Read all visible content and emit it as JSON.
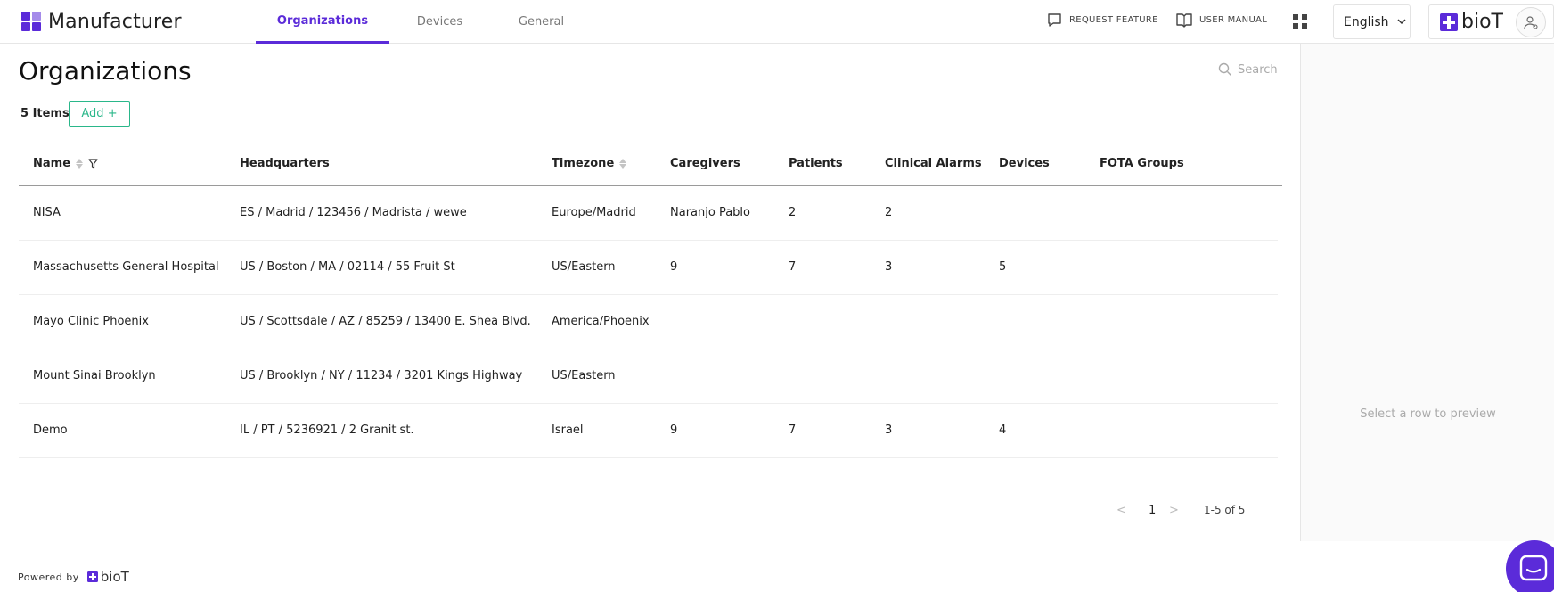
{
  "app": {
    "brand_name": "Manufacturer",
    "company_logo_text": "bioT",
    "brand_color": "#5b2bd9",
    "accent_color": "#2ab78a"
  },
  "nav": {
    "tabs": [
      {
        "label": "Organizations",
        "active": true
      },
      {
        "label": "Devices",
        "active": false
      },
      {
        "label": "General",
        "active": false
      }
    ]
  },
  "header": {
    "request_feature": "REQUEST FEATURE",
    "user_manual": "USER MANUAL",
    "language": "English"
  },
  "main": {
    "title": "Organizations",
    "search_placeholder": "Search",
    "item_count": "5 Items",
    "add_label": "Add +"
  },
  "table": {
    "columns": [
      "Name",
      "Headquarters",
      "Timezone",
      "Caregivers",
      "Patients",
      "Clinical Alarms",
      "Devices",
      "FOTA Groups"
    ],
    "rows": [
      {
        "name": "NISA",
        "hq": "ES / Madrid / 123456 / Madrista / wewe",
        "tz": "Europe/Madrid",
        "caregivers": "Naranjo Pablo",
        "patients": "2",
        "alarms": "2",
        "devices": "",
        "fota": ""
      },
      {
        "name": "Massachusetts General Hospital",
        "hq": "US / Boston / MA / 02114 / 55 Fruit St",
        "tz": "US/Eastern",
        "caregivers": "9",
        "patients": "7",
        "alarms": "3",
        "devices": "5",
        "fota": ""
      },
      {
        "name": "Mayo Clinic Phoenix",
        "hq": "US / Scottsdale / AZ / 85259 / 13400 E. Shea Blvd.",
        "tz": "America/Phoenix",
        "caregivers": "",
        "patients": "",
        "alarms": "",
        "devices": "",
        "fota": ""
      },
      {
        "name": "Mount Sinai Brooklyn",
        "hq": "US / Brooklyn / NY / 11234 / 3201 Kings Highway",
        "tz": "US/Eastern",
        "caregivers": "",
        "patients": "",
        "alarms": "",
        "devices": "",
        "fota": ""
      },
      {
        "name": "Demo",
        "hq": "IL / PT / 5236921 / 2 Granit st.",
        "tz": "Israel",
        "caregivers": "9",
        "patients": "7",
        "alarms": "3",
        "devices": "4",
        "fota": ""
      }
    ]
  },
  "pagination": {
    "prev": "<",
    "page": "1",
    "next": ">",
    "range": "1-5 of 5"
  },
  "preview": {
    "empty_text": "Select a row to preview"
  },
  "footer": {
    "powered_by": "Powered by",
    "logo_text": "bioT"
  }
}
